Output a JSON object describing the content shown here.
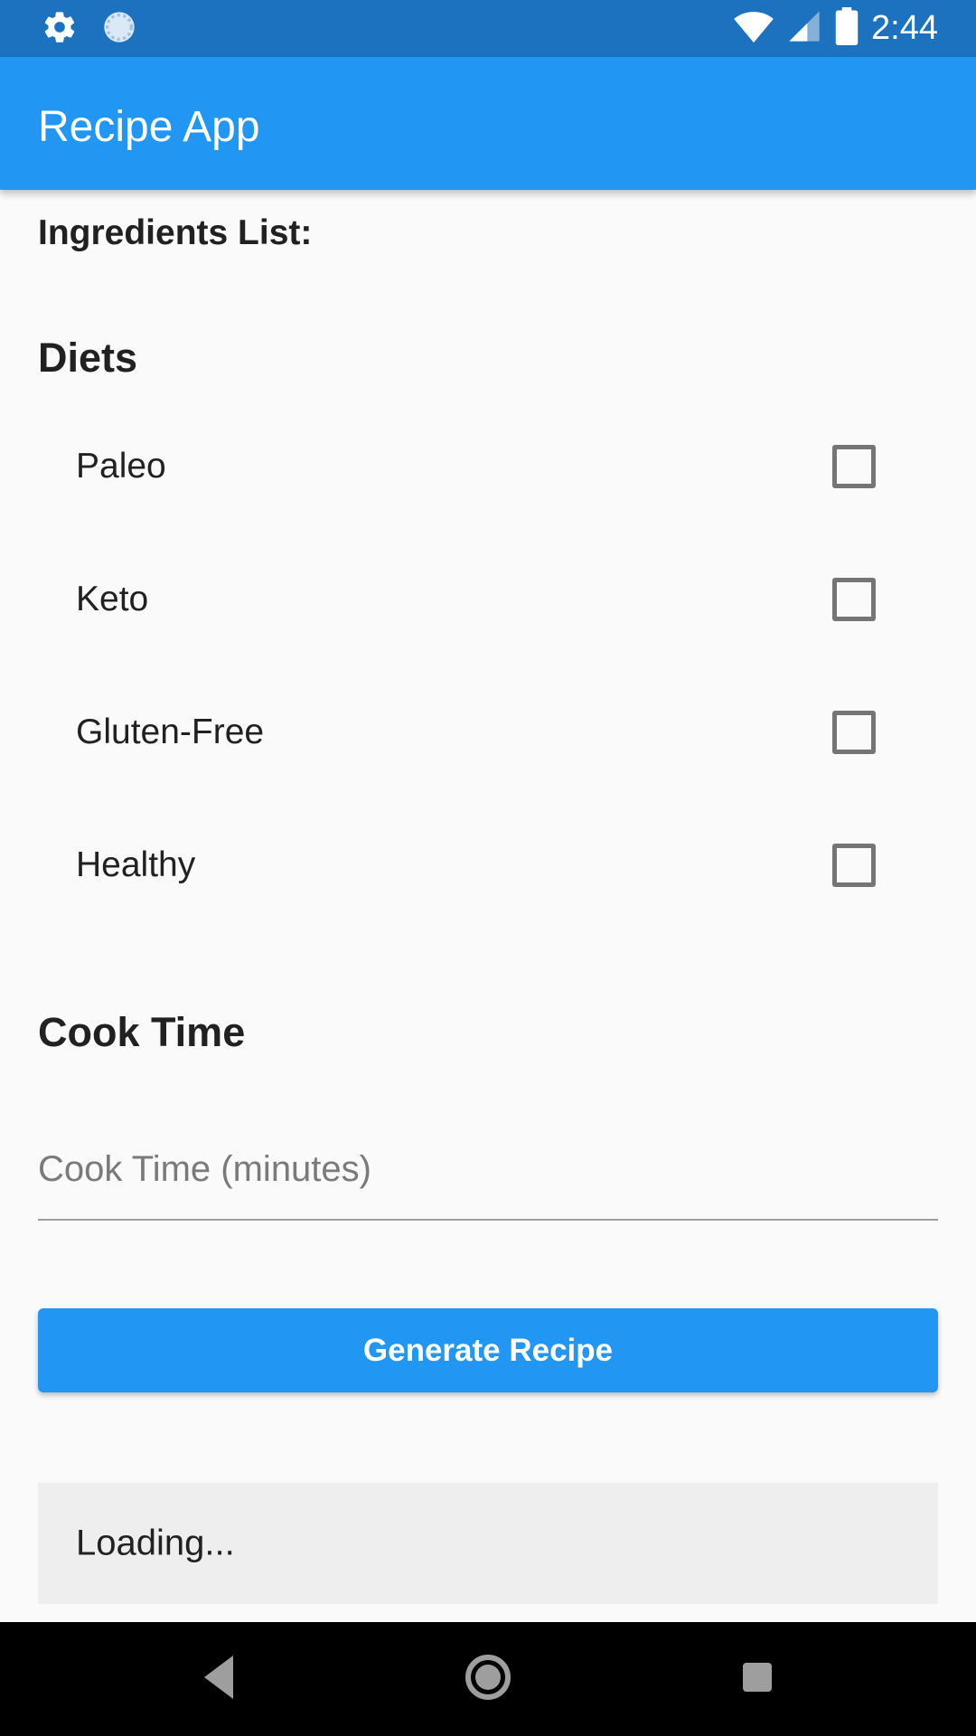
{
  "status_bar": {
    "time": "2:44",
    "left_icons": [
      "gear-icon",
      "sync-icon"
    ],
    "right_icons": [
      "wifi-icon",
      "cell-signal-icon",
      "battery-icon"
    ],
    "bg_color": "#1d72bf"
  },
  "app_bar": {
    "title": "Recipe App",
    "bg_color": "#2196f3"
  },
  "ingredients": {
    "label": "Ingredients List:"
  },
  "diets": {
    "title": "Diets",
    "options": [
      {
        "label": "Paleo",
        "checked": false
      },
      {
        "label": "Keto",
        "checked": false
      },
      {
        "label": "Gluten-Free",
        "checked": false
      },
      {
        "label": "Healthy",
        "checked": false
      }
    ]
  },
  "cook_time": {
    "title": "Cook Time",
    "input_value": "",
    "placeholder": "Cook Time (minutes)"
  },
  "generate_button": {
    "label": "Generate Recipe",
    "color": "#2196f3"
  },
  "result": {
    "text": "Loading..."
  },
  "nav_bar": {
    "buttons": [
      "back-icon",
      "home-icon",
      "recents-icon"
    ]
  }
}
